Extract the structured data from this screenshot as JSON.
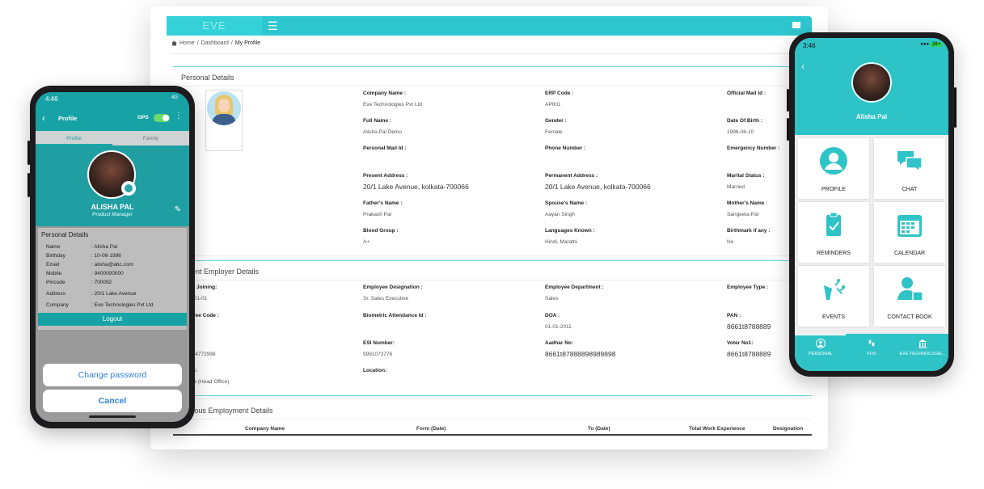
{
  "desktop": {
    "brand": "EVE",
    "breadcrumb": {
      "home": "Home",
      "dashboard": "Dashboard",
      "current": "My Profile"
    },
    "personal_section_title": "Personal Details",
    "employer_section_title": "rent Employer Details",
    "previous_section_title": "vious Employment Details",
    "personal_fields": [
      {
        "label": "Company Name :",
        "value": "Eve Technologies Pvt Ltd"
      },
      {
        "label": "ERP Code :",
        "value": "AP001"
      },
      {
        "label": "Official Mail Id :",
        "value": ""
      },
      {
        "label": "Full Name :",
        "value": "Alisha Pal Demo"
      },
      {
        "label": "Gender :",
        "value": "Female"
      },
      {
        "label": "Date Of Birth :",
        "value": "1996-06-10"
      },
      {
        "label": "Personal Mail Id :",
        "value": ""
      },
      {
        "label": "Phone Number :",
        "value": ""
      },
      {
        "label": "Emergency Number :",
        "value": ""
      },
      {
        "label": "Present Address :",
        "value": "20/1 Lake Avenue, kolkata-700066"
      },
      {
        "label": "Permanent Address :",
        "value": "20/1 Lake Avenue, kolkata-700066"
      },
      {
        "label": "Marital Status :",
        "value": "Married"
      },
      {
        "label": "Father's Name :",
        "value": "Prakash Pal"
      },
      {
        "label": "Spouse's Name :",
        "value": "Aayan Singh"
      },
      {
        "label": "Mother's Name :",
        "value": "Sangeeta Pal"
      },
      {
        "label": "Blood Group :",
        "value": "A+"
      },
      {
        "label": "Languages Known :",
        "value": "Hindi, Marathi"
      },
      {
        "label": "Birthmark if any :",
        "value": "No"
      }
    ],
    "employer_fields": [
      {
        "label": "Of Joining:",
        "value": "2-01-01"
      },
      {
        "label": "Employee Designation :",
        "value": "Sr. Sales Executive"
      },
      {
        "label": "Employee Department :",
        "value": "Sales"
      },
      {
        "label": "Employee Type :",
        "value": ""
      },
      {
        "label": "oyee Code :",
        "value": "01"
      },
      {
        "label": "Biometric Attendance Id :",
        "value": ""
      },
      {
        "label": "DOA :",
        "value": "01-01-2011"
      },
      {
        "label": "PAN :",
        "value": "8661t8788889"
      },
      {
        "label": ":",
        "value": "294772998"
      },
      {
        "label": "ESI Number:",
        "value": "9991073776"
      },
      {
        "label": "Aadhar No:",
        "value": "8661t87888898989898"
      },
      {
        "label": "Voter No1:",
        "value": "8661t8788889"
      },
      {
        "label": "ch:",
        "value": "ata (Head Office)"
      },
      {
        "label": "Location:",
        "value": ""
      }
    ],
    "table_columns": [
      "Company Name",
      "Form (Date)",
      "To (Date)",
      "Total Work Experience",
      "Designation"
    ]
  },
  "left_phone": {
    "time": "4:46",
    "signal": "4G",
    "title": "Profile",
    "gps_label": "GPS",
    "tabs": [
      "Profile",
      "Family"
    ],
    "name": "ALISHA PAL",
    "role": "Product Manager",
    "card_title": "Personal Details",
    "rows": [
      {
        "k": "Name",
        "v": ": Alisha Pal"
      },
      {
        "k": "Birthday",
        "v": ": 10-06-1996"
      },
      {
        "k": "Email",
        "v": ": alisha@abc.com"
      },
      {
        "k": "Mobile",
        "v": ": 9400000000"
      },
      {
        "k": "Pincode",
        "v": ": 700092"
      },
      {
        "k": "Address",
        "v": ": 20/1 Lake Avenue"
      },
      {
        "k": "Company",
        "v": ": Eve Technologies Pvt Ltd"
      }
    ],
    "logout": "Logout",
    "change_password": "Change password",
    "cancel": "Cancel"
  },
  "right_phone": {
    "time": "3:46",
    "battery": "28+",
    "name": "Alisha Pal",
    "tiles": [
      "PROFILE",
      "CHAT",
      "REMINDERS",
      "CALENDAR",
      "EVENTS",
      "CONTACT BOOK"
    ],
    "nav": [
      "PERSONAL",
      "FOS",
      "EVE TECHNOLOGIE..."
    ]
  },
  "colors": {
    "teal": "#2ec3c7",
    "teal_dark": "#17a2a5",
    "link_blue": "#2f7fd6"
  },
  "icons": [
    "menu-icon",
    "home-icon",
    "back-icon",
    "camera-icon",
    "pencil-icon",
    "profile-icon",
    "chat-icon",
    "reminders-icon",
    "calendar-icon",
    "events-icon",
    "contact-book-icon",
    "personal-nav-icon",
    "fos-nav-icon",
    "company-nav-icon"
  ]
}
